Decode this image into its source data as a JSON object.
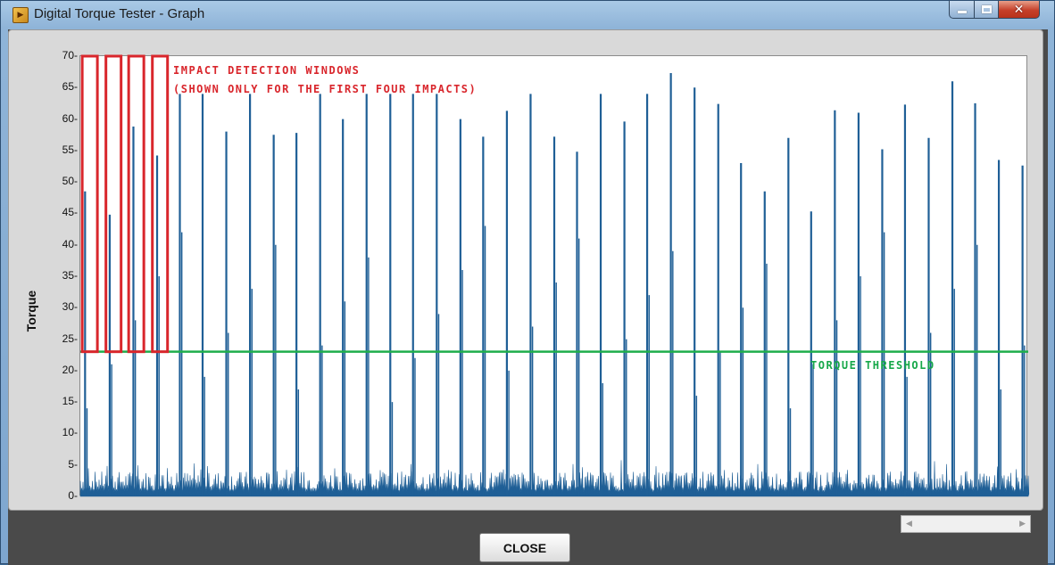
{
  "window": {
    "title": "Digital Torque Tester - Graph",
    "app_icon": "labview-icon"
  },
  "controls": {
    "close_label": "CLOSE"
  },
  "annotations": {
    "windows_line1": "IMPACT DETECTION WINDOWS",
    "windows_line2": "(SHOWN ONLY FOR THE FIRST FOUR IMPACTS)",
    "threshold_label": "TORQUE THRESHOLD"
  },
  "colors": {
    "signal": "#1f5f96",
    "threshold": "#1fae4b",
    "windows": "#d9262c"
  },
  "chart_data": {
    "type": "line",
    "title": "",
    "xlabel": "",
    "ylabel": "Torque",
    "ylim": [
      0,
      70
    ],
    "yticks": [
      0,
      5,
      10,
      15,
      20,
      25,
      30,
      35,
      40,
      45,
      50,
      55,
      60,
      65,
      70
    ],
    "xlim": [
      0,
      1
    ],
    "threshold": 23,
    "baseline_noise": [
      1,
      4
    ],
    "impacts": [
      {
        "x": 0.005,
        "peak": 48.5
      },
      {
        "x": 0.031,
        "peak": 44.8
      },
      {
        "x": 0.056,
        "peak": 58.8
      },
      {
        "x": 0.081,
        "peak": 54.2
      },
      {
        "x": 0.105,
        "peak": 64.0
      },
      {
        "x": 0.129,
        "peak": 64.0
      },
      {
        "x": 0.154,
        "peak": 58.0
      },
      {
        "x": 0.179,
        "peak": 64.0
      },
      {
        "x": 0.204,
        "peak": 57.5
      },
      {
        "x": 0.228,
        "peak": 57.8
      },
      {
        "x": 0.253,
        "peak": 64.0
      },
      {
        "x": 0.277,
        "peak": 60.0
      },
      {
        "x": 0.302,
        "peak": 64.0
      },
      {
        "x": 0.327,
        "peak": 64.0
      },
      {
        "x": 0.351,
        "peak": 64.0
      },
      {
        "x": 0.376,
        "peak": 64.0
      },
      {
        "x": 0.401,
        "peak": 60.0
      },
      {
        "x": 0.425,
        "peak": 57.2
      },
      {
        "x": 0.45,
        "peak": 61.3
      },
      {
        "x": 0.475,
        "peak": 64.0
      },
      {
        "x": 0.5,
        "peak": 57.2
      },
      {
        "x": 0.524,
        "peak": 54.8
      },
      {
        "x": 0.549,
        "peak": 64.0
      },
      {
        "x": 0.574,
        "peak": 59.6
      },
      {
        "x": 0.598,
        "peak": 64.0
      },
      {
        "x": 0.623,
        "peak": 67.3
      },
      {
        "x": 0.648,
        "peak": 65.0
      },
      {
        "x": 0.673,
        "peak": 62.4
      },
      {
        "x": 0.697,
        "peak": 53.0
      },
      {
        "x": 0.722,
        "peak": 48.5
      },
      {
        "x": 0.747,
        "peak": 57.0
      },
      {
        "x": 0.771,
        "peak": 45.3
      },
      {
        "x": 0.796,
        "peak": 61.4
      },
      {
        "x": 0.821,
        "peak": 61.0
      },
      {
        "x": 0.846,
        "peak": 55.2
      },
      {
        "x": 0.87,
        "peak": 62.3
      },
      {
        "x": 0.895,
        "peak": 57.0
      },
      {
        "x": 0.92,
        "peak": 66.0
      },
      {
        "x": 0.944,
        "peak": 62.5
      },
      {
        "x": 0.969,
        "peak": 53.5
      },
      {
        "x": 0.994,
        "peak": 52.6
      }
    ],
    "detection_windows": [
      {
        "x0": 0.002,
        "x1": 0.018,
        "y0": 23,
        "y1": 70
      },
      {
        "x0": 0.027,
        "x1": 0.043,
        "y0": 23,
        "y1": 70
      },
      {
        "x0": 0.051,
        "x1": 0.067,
        "y0": 23,
        "y1": 70
      },
      {
        "x0": 0.076,
        "x1": 0.092,
        "y0": 23,
        "y1": 70
      }
    ]
  }
}
